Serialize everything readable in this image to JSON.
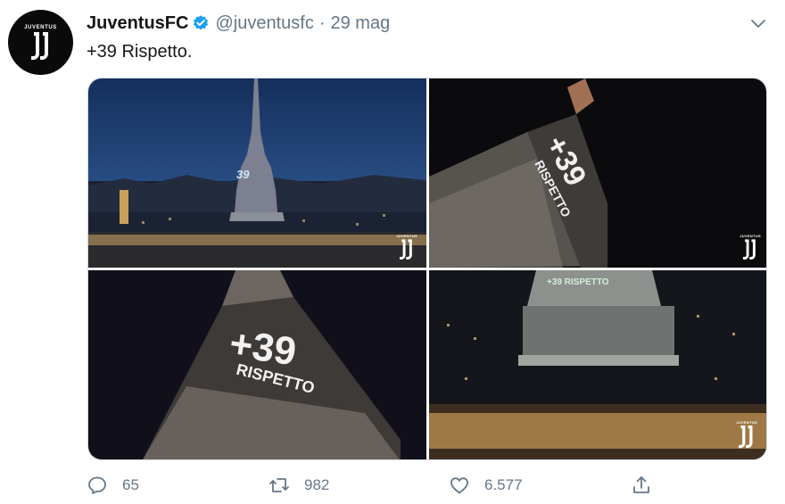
{
  "tweet": {
    "author_name": "JuventusFC",
    "handle": "@juventusfc",
    "separator": "·",
    "date": "29 mag",
    "text": "+39 Rispetto.",
    "avatar_text": "JUVENTUS",
    "verified_icon": "verified-badge-icon",
    "menu_icon": "chevron-down-icon"
  },
  "media": {
    "photos": [
      {
        "projection_text": "39",
        "watermark_text": "JUVENTUS"
      },
      {
        "projection_text": "+39",
        "projection_word": "RISPETTO",
        "watermark_text": "JUVENTUS"
      },
      {
        "projection_text": "+39",
        "projection_word": "RISPETTO"
      },
      {
        "projection_text": "+39 RISPETTO",
        "watermark_text": "JUVENTUS"
      }
    ]
  },
  "actions": {
    "reply_count": "65",
    "retweet_count": "982",
    "like_count": "6.577",
    "icons": [
      "reply-icon",
      "retweet-icon",
      "like-icon",
      "share-icon"
    ]
  },
  "colors": {
    "text_primary": "#14171a",
    "text_secondary": "#657786",
    "verified_blue": "#1da1f2",
    "border": "#ccd6dd"
  }
}
